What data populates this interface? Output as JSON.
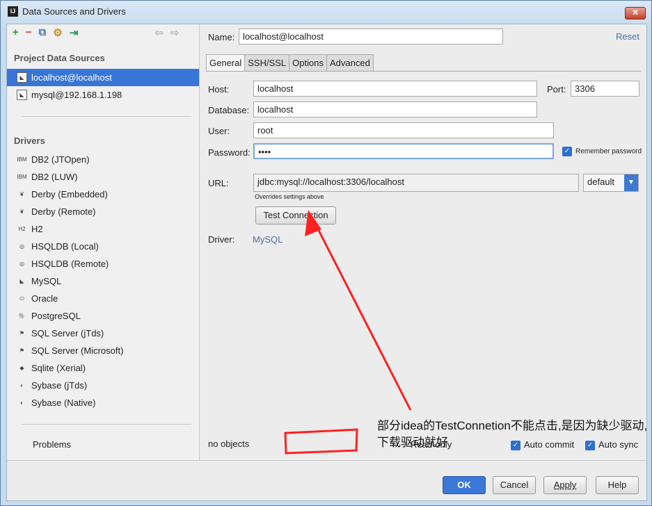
{
  "window": {
    "title": "Data Sources and Drivers",
    "logo": "IJ"
  },
  "left": {
    "project_heading": "Project Data Sources",
    "sources": [
      "localhost@localhost",
      "mysql@192.168.1.198"
    ],
    "drivers_heading": "Drivers",
    "drivers": [
      {
        "label": "DB2 (JTOpen)",
        "icon": "IBM"
      },
      {
        "label": "DB2 (LUW)",
        "icon": "IBM"
      },
      {
        "label": "Derby (Embedded)",
        "icon": "leaf"
      },
      {
        "label": "Derby (Remote)",
        "icon": "leaf"
      },
      {
        "label": "H2",
        "icon": "H2"
      },
      {
        "label": "HSQLDB (Local)",
        "icon": "hsql"
      },
      {
        "label": "HSQLDB (Remote)",
        "icon": "hsql"
      },
      {
        "label": "MySQL",
        "icon": "mysql"
      },
      {
        "label": "Oracle",
        "icon": "oracle"
      },
      {
        "label": "PostgreSQL",
        "icon": "elephant"
      },
      {
        "label": "SQL Server (jTds)",
        "icon": "sqlserver"
      },
      {
        "label": "SQL Server (Microsoft)",
        "icon": "sqlserver"
      },
      {
        "label": "Sqlite (Xerial)",
        "icon": "sqlite"
      },
      {
        "label": "Sybase (jTds)",
        "icon": "sybase"
      },
      {
        "label": "Sybase (Native)",
        "icon": "sybase"
      }
    ],
    "problems": "Problems"
  },
  "form": {
    "name_label": "Name:",
    "name_value": "localhost@localhost",
    "reset": "Reset",
    "tabs": [
      "General",
      "SSH/SSL",
      "Options",
      "Advanced"
    ],
    "host_label": "Host:",
    "host": "localhost",
    "port_label": "Port:",
    "port": "3306",
    "database_label": "Database:",
    "database": "localhost",
    "user_label": "User:",
    "user": "root",
    "password_label": "Password:",
    "password": "••••",
    "remember": "Remember password",
    "url_label": "URL:",
    "url": "jdbc:mysql://localhost:3306/localhost",
    "url_mode": "default",
    "url_hint": "Overrides settings above",
    "test": "Test Connection",
    "driver_label": "Driver:",
    "driver": "MySQL",
    "status": "no objects",
    "read_only": "Read-only",
    "auto_commit": "Auto commit",
    "auto_sync": "Auto sync"
  },
  "annotation": {
    "text": "部分idea的TestConnetion不能点击,是因为缺少驱动,下载驱动就好",
    "color": "#ff2020"
  },
  "buttons": {
    "ok": "OK",
    "cancel": "Cancel",
    "apply": "Apply",
    "help": "Help"
  }
}
